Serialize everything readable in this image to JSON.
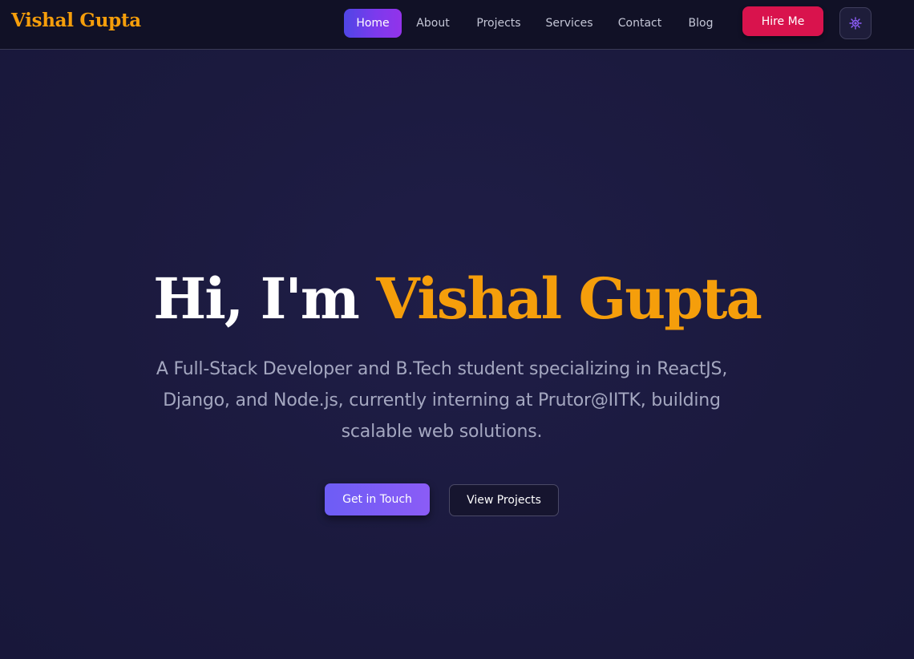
{
  "brand": {
    "name": "Vishal Gupta"
  },
  "nav": {
    "items": [
      {
        "label": "Home",
        "active": true
      },
      {
        "label": "About",
        "active": false
      },
      {
        "label": "Projects",
        "active": false
      },
      {
        "label": "Services",
        "active": false
      },
      {
        "label": "Contact",
        "active": false
      },
      {
        "label": "Blog",
        "active": false
      }
    ],
    "hire_label": "Hire Me",
    "theme_icon": "gear-icon"
  },
  "hero": {
    "greeting": "Hi, I'm",
    "name": "Vishal Gupta",
    "subtitle": "A Full-Stack Developer and B.Tech student specializing in ReactJS, Django, and Node.js, currently interning at Prutor@IITK, building scalable web solutions.",
    "primary_button": "Get in Touch",
    "secondary_button": "View Projects"
  },
  "colors": {
    "accent": "#f59e0b",
    "hire": "#d9134d",
    "primary_gradient_start": "#6d5df5",
    "primary_gradient_end": "#8b5cf6",
    "background": "#1b1a3d"
  }
}
